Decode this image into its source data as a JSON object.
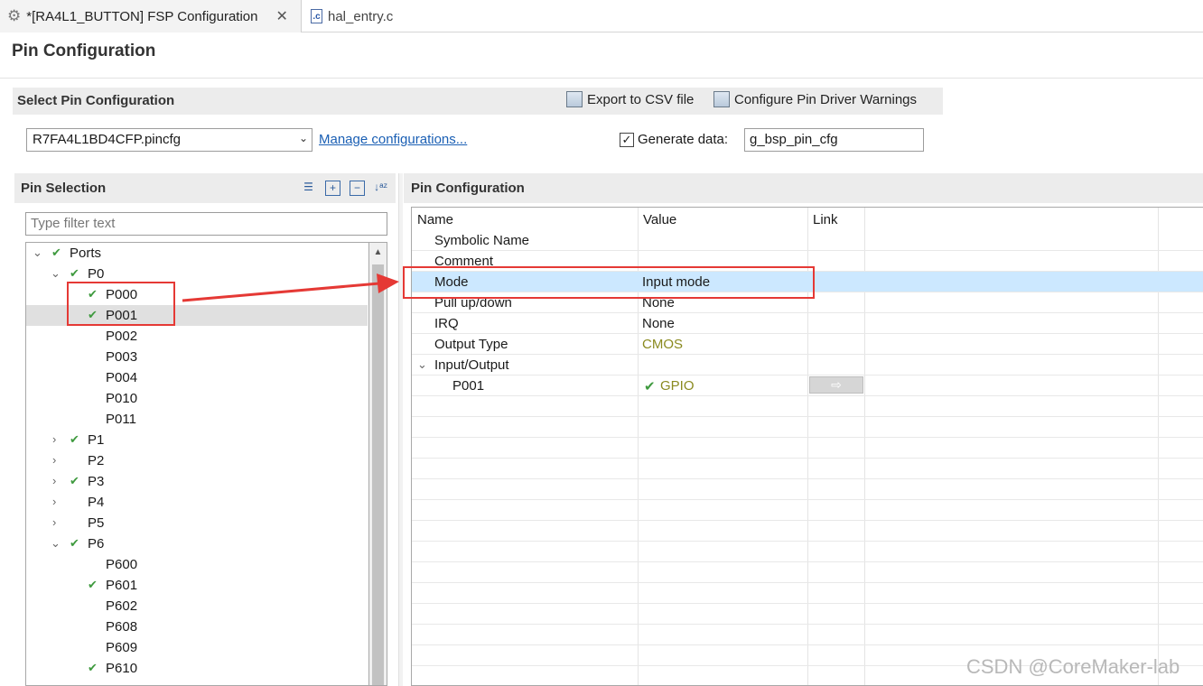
{
  "tabs": [
    {
      "label": "*[RA4L1_BUTTON] FSP Configuration",
      "close": "✕"
    },
    {
      "label": "hal_entry.c",
      "file_badge": ".c"
    }
  ],
  "page_title": "Pin Configuration",
  "select_section": {
    "title": "Select Pin Configuration",
    "export_label": "Export to CSV file",
    "warnings_label": "Configure Pin Driver Warnings",
    "selected_file": "R7FA4L1BD4CFP.pincfg",
    "manage_link": "Manage configurations...",
    "generate_checked": "✓",
    "generate_label": "Generate data:",
    "generate_value": "g_bsp_pin_cfg"
  },
  "pin_selection": {
    "title": "Pin Selection",
    "filter_placeholder": "Type filter text",
    "tree": [
      {
        "label": "Ports",
        "twisty": "⌄",
        "check": "✔"
      },
      {
        "label": "P0",
        "twisty": "⌄",
        "check": "✔"
      },
      {
        "label": "P000",
        "twisty": "",
        "check": "✔"
      },
      {
        "label": "P001",
        "twisty": "",
        "check": "✔"
      },
      {
        "label": "P002",
        "twisty": "",
        "check": ""
      },
      {
        "label": "P003",
        "twisty": "",
        "check": ""
      },
      {
        "label": "P004",
        "twisty": "",
        "check": ""
      },
      {
        "label": "P010",
        "twisty": "",
        "check": ""
      },
      {
        "label": "P011",
        "twisty": "",
        "check": ""
      },
      {
        "label": "P1",
        "twisty": "›",
        "check": "✔"
      },
      {
        "label": "P2",
        "twisty": "›",
        "check": ""
      },
      {
        "label": "P3",
        "twisty": "›",
        "check": "✔"
      },
      {
        "label": "P4",
        "twisty": "›",
        "check": ""
      },
      {
        "label": "P5",
        "twisty": "›",
        "check": ""
      },
      {
        "label": "P6",
        "twisty": "⌄",
        "check": "✔"
      },
      {
        "label": "P600",
        "twisty": "",
        "check": ""
      },
      {
        "label": "P601",
        "twisty": "",
        "check": "✔"
      },
      {
        "label": "P602",
        "twisty": "",
        "check": ""
      },
      {
        "label": "P608",
        "twisty": "",
        "check": ""
      },
      {
        "label": "P609",
        "twisty": "",
        "check": ""
      },
      {
        "label": "P610",
        "twisty": "",
        "check": "✔"
      }
    ]
  },
  "pin_config": {
    "title": "Pin Configuration",
    "columns": [
      "Name",
      "Value",
      "Link"
    ],
    "rows": [
      {
        "name": "Symbolic Name",
        "value": ""
      },
      {
        "name": "Comment",
        "value": ""
      },
      {
        "name": "Mode",
        "value": "Input mode"
      },
      {
        "name": "Pull up/down",
        "value": "None"
      },
      {
        "name": "IRQ",
        "value": "None"
      },
      {
        "name": "Output Type",
        "value": "CMOS"
      },
      {
        "name": "Input/Output",
        "value": "",
        "twisty": "⌄"
      },
      {
        "name": "P001",
        "value": "GPIO",
        "check": "✔"
      }
    ]
  },
  "watermark": "CSDN @CoreMaker-lab",
  "colors": {
    "accent": "#1a5fb4",
    "selection": "#cce8ff",
    "check": "#3f9a3f",
    "annotation": "#e53935"
  }
}
